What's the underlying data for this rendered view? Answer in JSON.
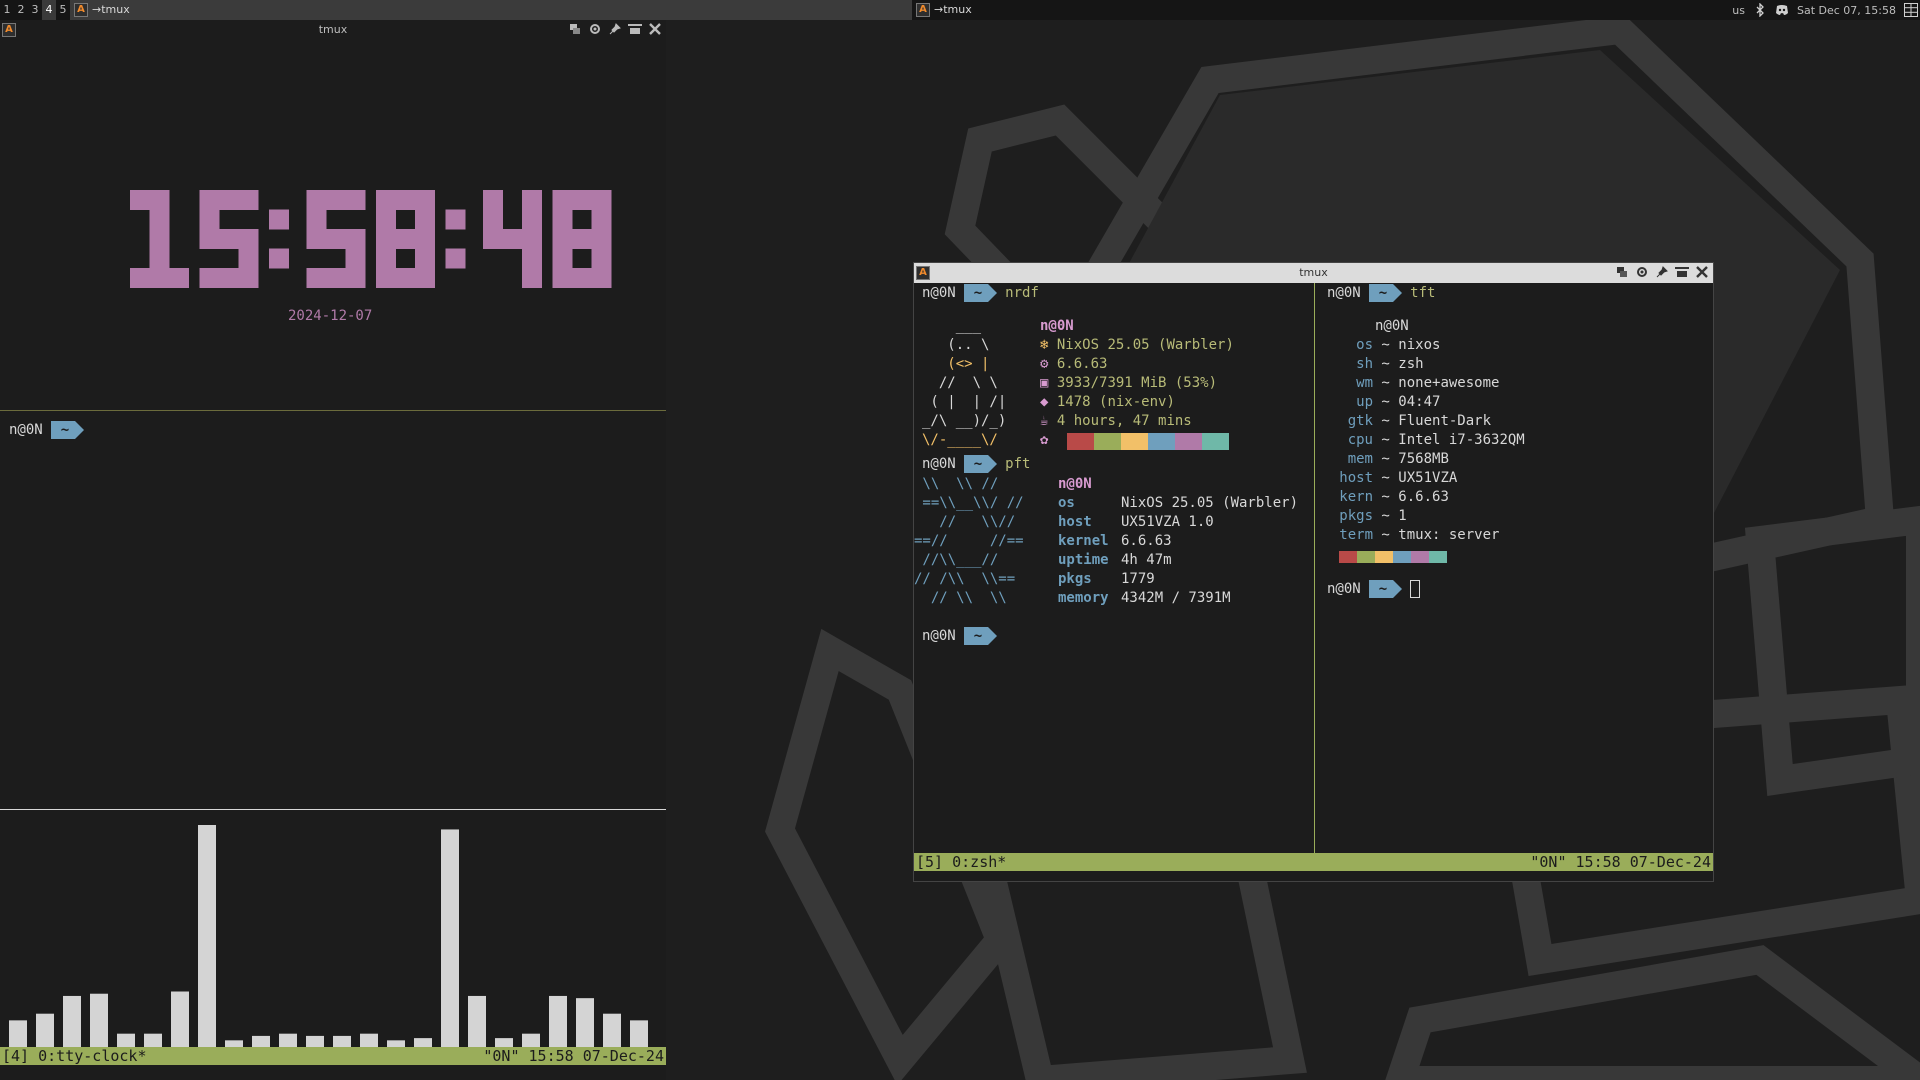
{
  "topbar": {
    "tags": [
      "1",
      "2",
      "3",
      "4",
      "5"
    ],
    "active_tag": "4",
    "tasks": [
      {
        "title": "→tmux",
        "focused": true
      },
      {
        "title": "→tmux",
        "focused": false
      }
    ],
    "keyboard_layout": "us",
    "datetime": "Sat Dec 07, 15:58"
  },
  "left_window": {
    "title": "tmux",
    "clock": {
      "time": "15:58:48",
      "date": "2024-12-07",
      "color": "#b07aa8"
    },
    "prompt_user": "n@0N",
    "prompt_dir": "~",
    "visualizer": {
      "levels": [
        12,
        15,
        23,
        24,
        6,
        6,
        25,
        100,
        3,
        5,
        6,
        5,
        5,
        6,
        3,
        4,
        98,
        23,
        4,
        6,
        23,
        22,
        15,
        12
      ]
    },
    "status_left": "[4] 0:tty-clock*",
    "status_right": "\"0N\" 15:58 07-Dec-24"
  },
  "right_window": {
    "title": "tmux",
    "left_pane": {
      "prompt_user": "n@0N",
      "prompt_dir": "~",
      "cmd1": "nrdf",
      "nrdf_ascii": [
        "    ___",
        "   (.. \\",
        "   (<> |",
        "  //  \\ \\",
        " ( |  | /|",
        "_/\\ __)/_)",
        "\\/-____\\/"
      ],
      "nrdf_user": "n@0N",
      "nrdf_rows": [
        {
          "icon": "❄",
          "value": "NixOS 25.05 (Warbler)"
        },
        {
          "icon": "⚙",
          "value": "6.6.63"
        },
        {
          "icon": "▣",
          "value": "3933/7391 MiB (53%)"
        },
        {
          "icon": "◆",
          "value": "1478 (nix-env)"
        },
        {
          "icon": "☕",
          "value": "4 hours, 47 mins"
        },
        {
          "icon": "✿",
          "value": ""
        }
      ],
      "cmd2": "pft",
      "pft_ascii": [
        " \\\\  \\\\ //",
        " ==\\\\__\\\\/ //",
        "   //   \\\\//",
        "==//     //==",
        " //\\\\___//",
        "// /\\\\  \\\\==",
        "  // \\\\  \\\\"
      ],
      "pft_user": "n@0N",
      "pft_rows": [
        {
          "label": "os",
          "value": "NixOS 25.05 (Warbler)"
        },
        {
          "label": "host",
          "value": "UX51VZA 1.0"
        },
        {
          "label": "kernel",
          "value": "6.6.63"
        },
        {
          "label": "uptime",
          "value": "4h 47m"
        },
        {
          "label": "pkgs",
          "value": "1779"
        },
        {
          "label": "memory",
          "value": "4342M / 7391M"
        }
      ]
    },
    "right_pane": {
      "prompt_user": "n@0N",
      "prompt_dir": "~",
      "cmd": "tft",
      "tft_user": "n@0N",
      "tft_rows": [
        {
          "label": "os",
          "value": "nixos"
        },
        {
          "label": "sh",
          "value": "zsh"
        },
        {
          "label": "wm",
          "value": "none+awesome"
        },
        {
          "label": "up",
          "value": "04:47"
        },
        {
          "label": "gtk",
          "value": "Fluent-Dark"
        },
        {
          "label": "cpu",
          "value": "Intel i7-3632QM"
        },
        {
          "label": "mem",
          "value": "7568MB"
        },
        {
          "label": "host",
          "value": "UX51VZA"
        },
        {
          "label": "kern",
          "value": "6.6.63"
        },
        {
          "label": "pkgs",
          "value": "1"
        },
        {
          "label": "term",
          "value": "tmux: server"
        }
      ]
    },
    "palette": [
      "#b94a48",
      "#9aad5a",
      "#f2c068",
      "#6f9fbd",
      "#b07aa8",
      "#6fb8a8"
    ],
    "status_left": "[5] 0:zsh*",
    "status_right": "\"0N\" 15:58 07-Dec-24"
  },
  "colors": {
    "accent_green": "#9aad5a",
    "accent_blue": "#6f9fbd",
    "clock_pink": "#b07aa8"
  }
}
